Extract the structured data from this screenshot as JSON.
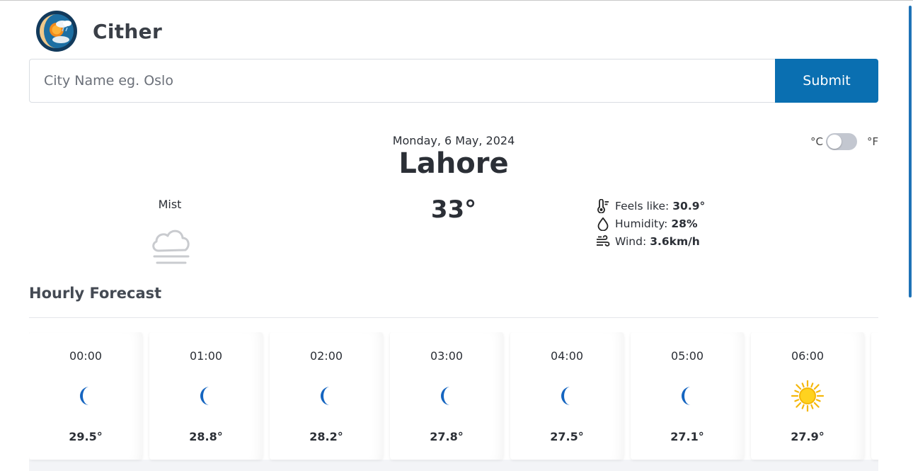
{
  "app": {
    "name": "Cither"
  },
  "search": {
    "placeholder": "City Name eg. Oslo",
    "value": "",
    "submit_label": "Submit"
  },
  "units": {
    "celsius": "°C",
    "fahrenheit": "°F",
    "selected": "celsius"
  },
  "current": {
    "date": "Monday, 6 May, 2024",
    "city": "Lahore",
    "condition": "Mist",
    "condition_icon": "mist-cloud-icon",
    "temperature": "33°",
    "feels_like_label": "Feels like:",
    "feels_like_value": "30.9°",
    "humidity_label": "Humidity:",
    "humidity_value": "28%",
    "wind_label": "Wind:",
    "wind_value": "3.6km/h"
  },
  "hourly": {
    "title": "Hourly Forecast",
    "items": [
      {
        "time": "00:00",
        "icon": "moon-icon",
        "temp": "29.5°"
      },
      {
        "time": "01:00",
        "icon": "moon-icon",
        "temp": "28.8°"
      },
      {
        "time": "02:00",
        "icon": "moon-icon",
        "temp": "28.2°"
      },
      {
        "time": "03:00",
        "icon": "moon-icon",
        "temp": "27.8°"
      },
      {
        "time": "04:00",
        "icon": "moon-icon",
        "temp": "27.5°"
      },
      {
        "time": "05:00",
        "icon": "moon-icon",
        "temp": "27.1°"
      },
      {
        "time": "06:00",
        "icon": "sun-icon",
        "temp": "27.9°"
      }
    ]
  },
  "colors": {
    "accent": "#0a6fb1",
    "moon": "#1565c0",
    "sun": "#f5b70a"
  }
}
